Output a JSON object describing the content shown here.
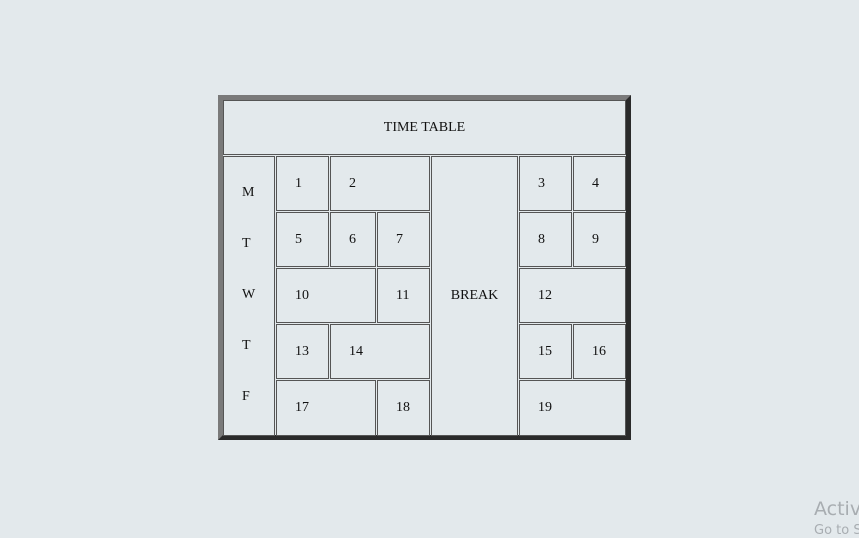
{
  "table": {
    "title": "TIME TABLE",
    "days": [
      "M",
      "T",
      "W",
      "T",
      "F"
    ],
    "break_label": "BREAK",
    "periods": [
      "1",
      "2",
      "3",
      "4",
      "5",
      "6",
      "7",
      "8",
      "9",
      "10",
      "11",
      "12",
      "13",
      "14",
      "15",
      "16",
      "17",
      "18",
      "19"
    ]
  },
  "watermark": {
    "line1": "Activ",
    "line2": "Go to S"
  }
}
